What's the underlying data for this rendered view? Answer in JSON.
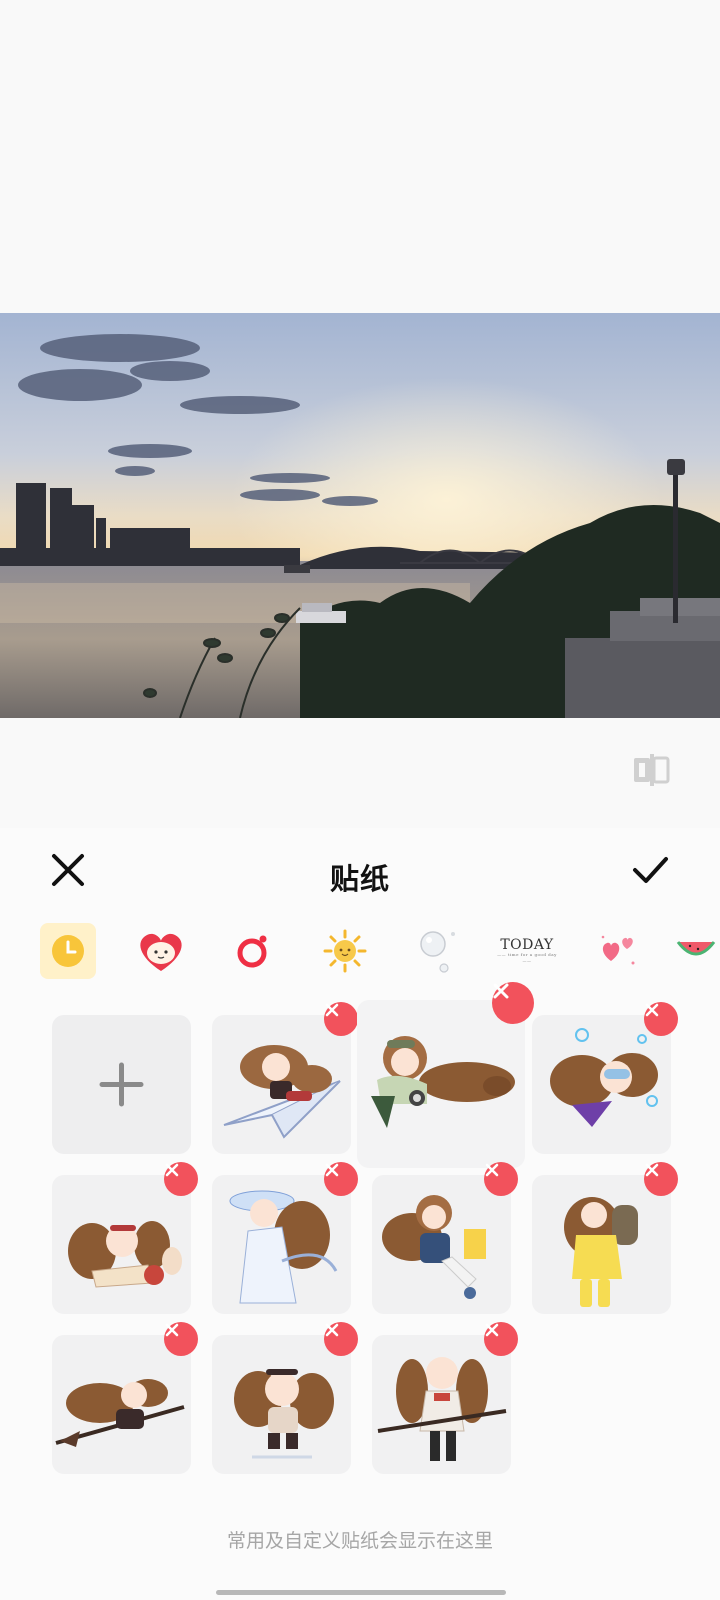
{
  "editor": {
    "compare_icon": "compare-toggle-icon"
  },
  "sheet": {
    "title": "贴纸",
    "close_icon": "close-icon",
    "confirm_icon": "checkmark-icon",
    "hint": "常用及自定义贴纸会显示在这里"
  },
  "tabs": [
    {
      "name": "recent",
      "icon": "clock-icon",
      "active": true
    },
    {
      "name": "heart-character",
      "icon": "heart-character-icon"
    },
    {
      "name": "ring",
      "icon": "ring-icon"
    },
    {
      "name": "sun",
      "icon": "sun-icon"
    },
    {
      "name": "bubbles",
      "icon": "bubbles-icon"
    },
    {
      "name": "today",
      "label": "TODAY",
      "sublabel": "—— time for a good day ——"
    },
    {
      "name": "hearts",
      "icon": "hearts-icon"
    },
    {
      "name": "watermelon",
      "icon": "watermelon-icon"
    }
  ],
  "stickers": [
    {
      "type": "add",
      "icon": "plus-icon"
    },
    {
      "type": "sticker",
      "name": "girl-on-paper-plane",
      "removable": true
    },
    {
      "type": "sticker",
      "name": "girl-lying-with-camera",
      "removable": true,
      "selected": true
    },
    {
      "type": "sticker",
      "name": "girl-underwater-snorkel",
      "removable": true
    },
    {
      "type": "sticker",
      "name": "girl-reading-book",
      "removable": true
    },
    {
      "type": "sticker",
      "name": "girl-white-dress-hat",
      "removable": true
    },
    {
      "type": "sticker",
      "name": "girl-sitting-shopping",
      "removable": true
    },
    {
      "type": "sticker",
      "name": "girl-yellow-raincoat",
      "removable": true
    },
    {
      "type": "sticker",
      "name": "girl-on-broom",
      "removable": true
    },
    {
      "type": "sticker",
      "name": "girl-sitting-headband",
      "removable": true
    },
    {
      "type": "sticker",
      "name": "girl-with-broom-standing",
      "removable": true
    }
  ],
  "colors": {
    "accent_yellow": "#f8c53a",
    "delete_red": "#f2525c",
    "tab_active_bg": "#fff1c9"
  }
}
